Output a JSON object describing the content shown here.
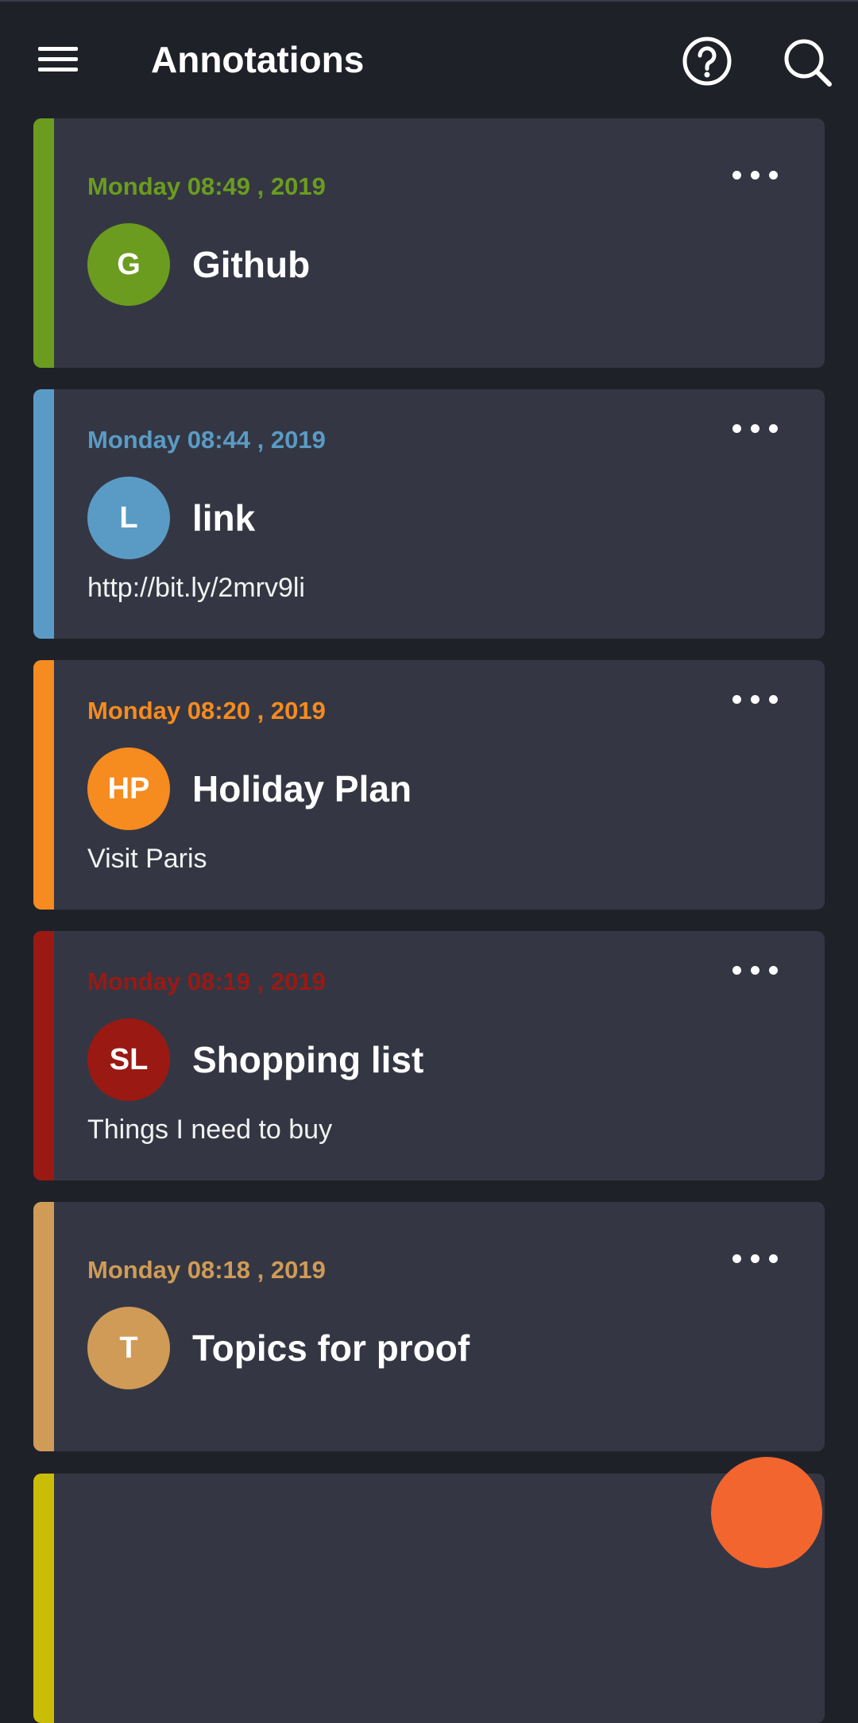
{
  "appbar": {
    "title": "Annotations",
    "icons": [
      "menu-icon",
      "help-icon",
      "search-icon"
    ]
  },
  "notes": [
    {
      "date": "Monday 08:49 , 2019",
      "initials": "G",
      "title": "Github",
      "description": "",
      "color": "#6b9c1f"
    },
    {
      "date": "Monday 08:44 , 2019",
      "initials": "L",
      "title": "link",
      "description": "http://bit.ly/2mrv9li",
      "color": "#5a9bc5"
    },
    {
      "date": "Monday 08:20 , 2019",
      "initials": "HP",
      "title": "Holiday Plan",
      "description": "Visit Paris",
      "color": "#f68b1f"
    },
    {
      "date": "Monday 08:19 , 2019",
      "initials": "SL",
      "title": "Shopping list",
      "description": "Things I need to buy",
      "color": "#9b1913"
    },
    {
      "date": "Monday 08:18 , 2019",
      "initials": "T",
      "title": "Topics for proof",
      "description": "",
      "color": "#d09b57"
    },
    {
      "date": "",
      "initials": "",
      "title": "",
      "description": "",
      "color": "#c9bd05"
    }
  ],
  "fab": {
    "color": "#f2652f"
  }
}
